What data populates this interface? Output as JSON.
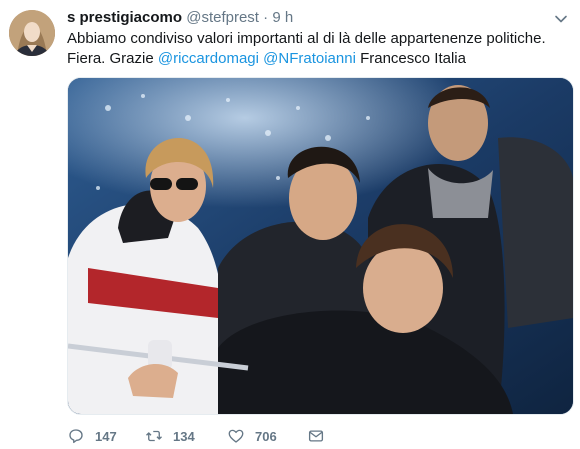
{
  "tweet": {
    "author_name": "s prestigiacomo",
    "handle": "@stefprest",
    "separator": "·",
    "time": "9 h",
    "text_intro": "Abbiamo condiviso valori importanti al di là delle appartenenze politiche. Fiera. Grazie",
    "mention_1": "@riccardomagi",
    "mention_2": "@NFratoianni",
    "text_outro": "Francesco Italia"
  },
  "actions": {
    "reply_count": "147",
    "retweet_count": "134",
    "like_count": "706"
  },
  "colors": {
    "link": "#1b95e0",
    "secondary_text": "#657786",
    "primary_text": "#14171a"
  },
  "icons": {
    "reply": "reply-icon",
    "retweet": "retweet-icon",
    "like": "heart-icon",
    "message": "envelope-icon",
    "caret": "chevron-down-icon"
  }
}
